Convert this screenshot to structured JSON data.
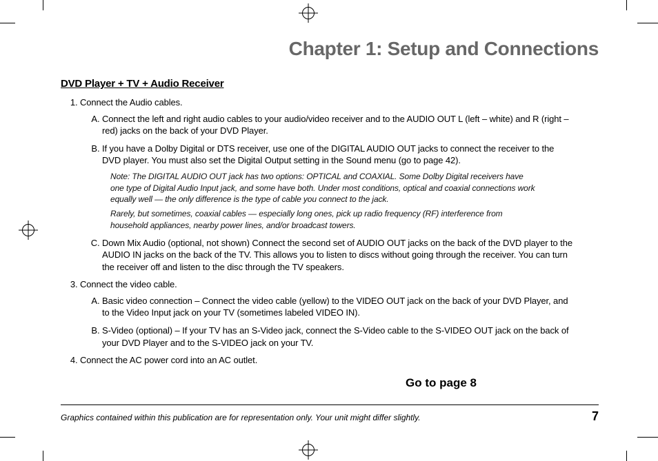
{
  "chapter_title": "Chapter 1: Setup and Connections",
  "section_title": "DVD Player + TV + Audio Receiver",
  "steps": {
    "s1": {
      "text": "Connect the Audio cables.",
      "a": "Connect the left and right audio cables to your audio/video receiver and to the AUDIO OUT L (left – white) and R (right – red) jacks on the back of your DVD Player.",
      "b": "If you have a Dolby Digital or DTS receiver, use one of the DIGITAL AUDIO OUT jacks to connect the receiver to the DVD player. You must also set the Digital Output setting in the Sound menu (go to page 42).",
      "note1": "Note: The DIGITAL AUDIO OUT jack has two options: OPTICAL and COAXIAL. Some Dolby Digital receivers have one type of Digital Audio Input jack, and some have both. Under most conditions, optical and coaxial connections work equally well — the only difference is the type of cable you connect to the jack.",
      "note2": "Rarely, but sometimes, coaxial cables — especially long ones, pick up radio frequency (RF) interference from household appliances, nearby power lines, and/or broadcast towers.",
      "c": "Down Mix Audio (optional, not shown) Connect the second set of AUDIO OUT jacks on the back of the DVD player to the AUDIO IN jacks on the back of the TV. This allows you to listen to discs without going through the receiver. You can turn the receiver off and listen to the disc through the TV speakers."
    },
    "s3": {
      "text": "Connect the video cable.",
      "a": "Basic video connection – Connect the video cable (yellow) to the VIDEO OUT jack on the back of your DVD Player, and to the Video Input jack on your TV (sometimes labeled VIDEO IN).",
      "b": "S-Video (optional) – If your TV has an S-Video jack, connect the S-Video cable to the S-VIDEO OUT jack on the back of your DVD Player and to the S-VIDEO jack on your TV."
    },
    "s4": {
      "text": "Connect the AC power cord into an AC outlet."
    }
  },
  "goto": "Go to page 8",
  "footer_text": "Graphics contained within this publication are for representation only. Your unit might differ slightly.",
  "page_number": "7"
}
